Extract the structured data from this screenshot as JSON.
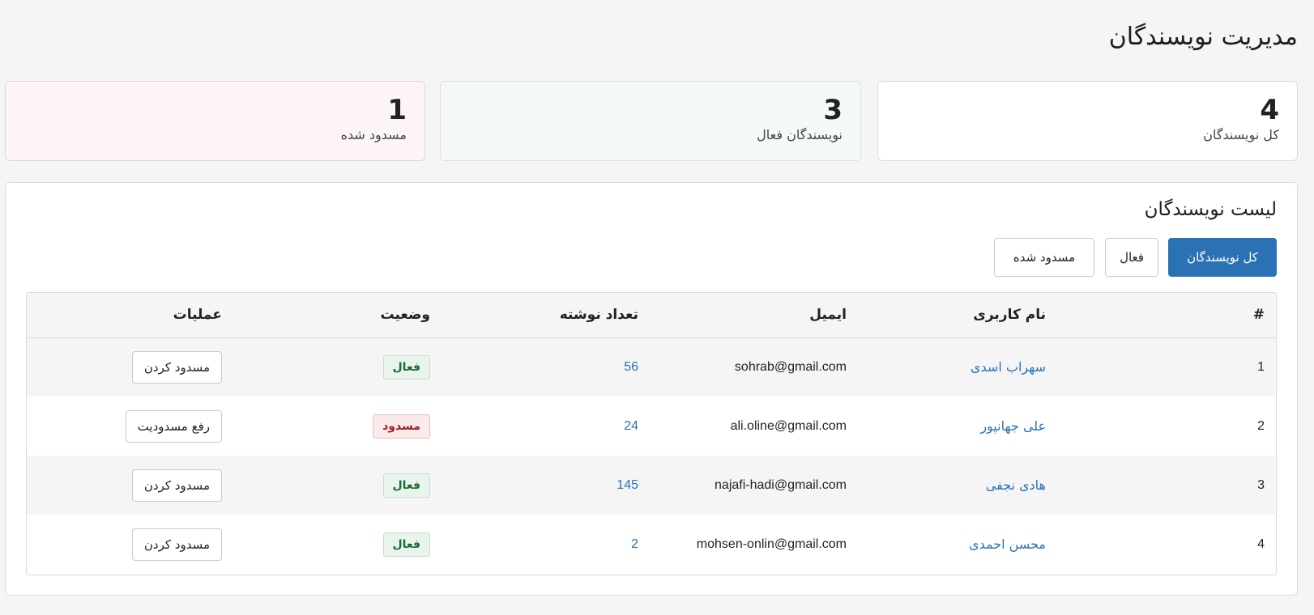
{
  "page": {
    "title": "مدیریت نویسندگان"
  },
  "stats": {
    "total": {
      "value": "4",
      "label": "کل نویسندگان"
    },
    "active": {
      "value": "3",
      "label": "نویسندگان فعال"
    },
    "blocked": {
      "value": "1",
      "label": "مسدود شده"
    }
  },
  "list": {
    "title": "لیست نویسندگان",
    "filters": {
      "all": "کل نویسندگان",
      "active": "فعال",
      "blocked": "مسدود شده"
    },
    "columns": {
      "num": "#",
      "username": "نام کاربری",
      "email": "ایمیل",
      "post_count": "تعداد نوشته",
      "status": "وضعیت",
      "operations": "عملیات"
    },
    "rows": [
      {
        "num": "1",
        "username": "سهراب اسدی",
        "email": "sohrab@gmail.com",
        "post_count": "56",
        "status": "فعال",
        "status_type": "active",
        "action": "مسدود کردن"
      },
      {
        "num": "2",
        "username": "علی جهانپور",
        "email": "ali.oline@gmail.com",
        "post_count": "24",
        "status": "مسدود",
        "status_type": "blocked",
        "action": "رفع مسدودیت"
      },
      {
        "num": "3",
        "username": "هادی نجفی",
        "email": "najafi-hadi@gmail.com",
        "post_count": "145",
        "status": "فعال",
        "status_type": "active",
        "action": "مسدود کردن"
      },
      {
        "num": "4",
        "username": "محسن احمدی",
        "email": "mohsen-onlin@gmail.com",
        "post_count": "2",
        "status": "فعال",
        "status_type": "active",
        "action": "مسدود کردن"
      }
    ]
  },
  "colors": {
    "primary": "#2b72b5",
    "active_bg": "#e9f5ec",
    "active_text": "#1d6a34",
    "blocked_bg": "#fbeaea",
    "blocked_text": "#a02222"
  }
}
